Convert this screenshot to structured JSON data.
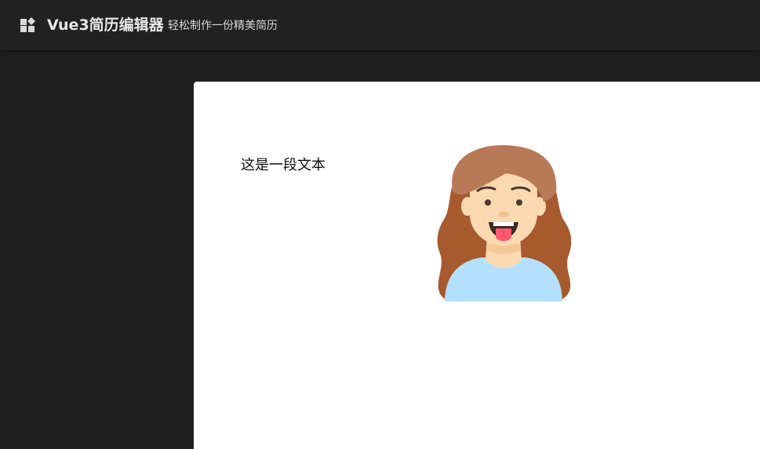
{
  "header": {
    "logo_icon": "widgets-icon",
    "title": "Vue3简历编辑器",
    "subtitle": "轻松制作一份精美简历"
  },
  "canvas": {
    "text_block": "这是一段文本",
    "avatar_icon": "girl-avatar-icon"
  },
  "colors": {
    "header_bg": "#212121",
    "workspace_bg": "#1f1f1f",
    "canvas_bg": "#ffffff",
    "hair": "#a65a2e",
    "hair_top": "#b87a56",
    "skin": "#fcd9b0",
    "shirt": "#b3e1fd",
    "tongue": "#fd5a72"
  }
}
